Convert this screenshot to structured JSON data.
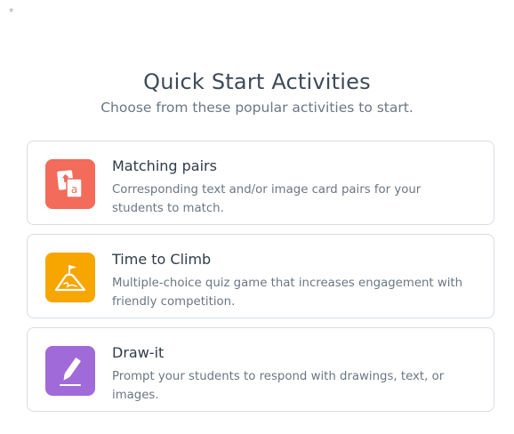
{
  "corner_mark": "*",
  "header": {
    "title": "Quick Start Activities",
    "subtitle": "Choose from these popular activities to start."
  },
  "activities": [
    {
      "title": "Matching pairs",
      "description": "Corresponding text and/or image card pairs for your students to match.",
      "icon": "matching-pairs-icon",
      "color": "#f26b5b"
    },
    {
      "title": "Time to Climb",
      "description": "Multiple-choice quiz game that increases engagement with friendly competition.",
      "icon": "mountain-flag-icon",
      "color": "#f7a600"
    },
    {
      "title": "Draw-it",
      "description": "Prompt your students to respond with drawings, text, or images.",
      "icon": "pencil-icon",
      "color": "#a06bd8"
    }
  ]
}
